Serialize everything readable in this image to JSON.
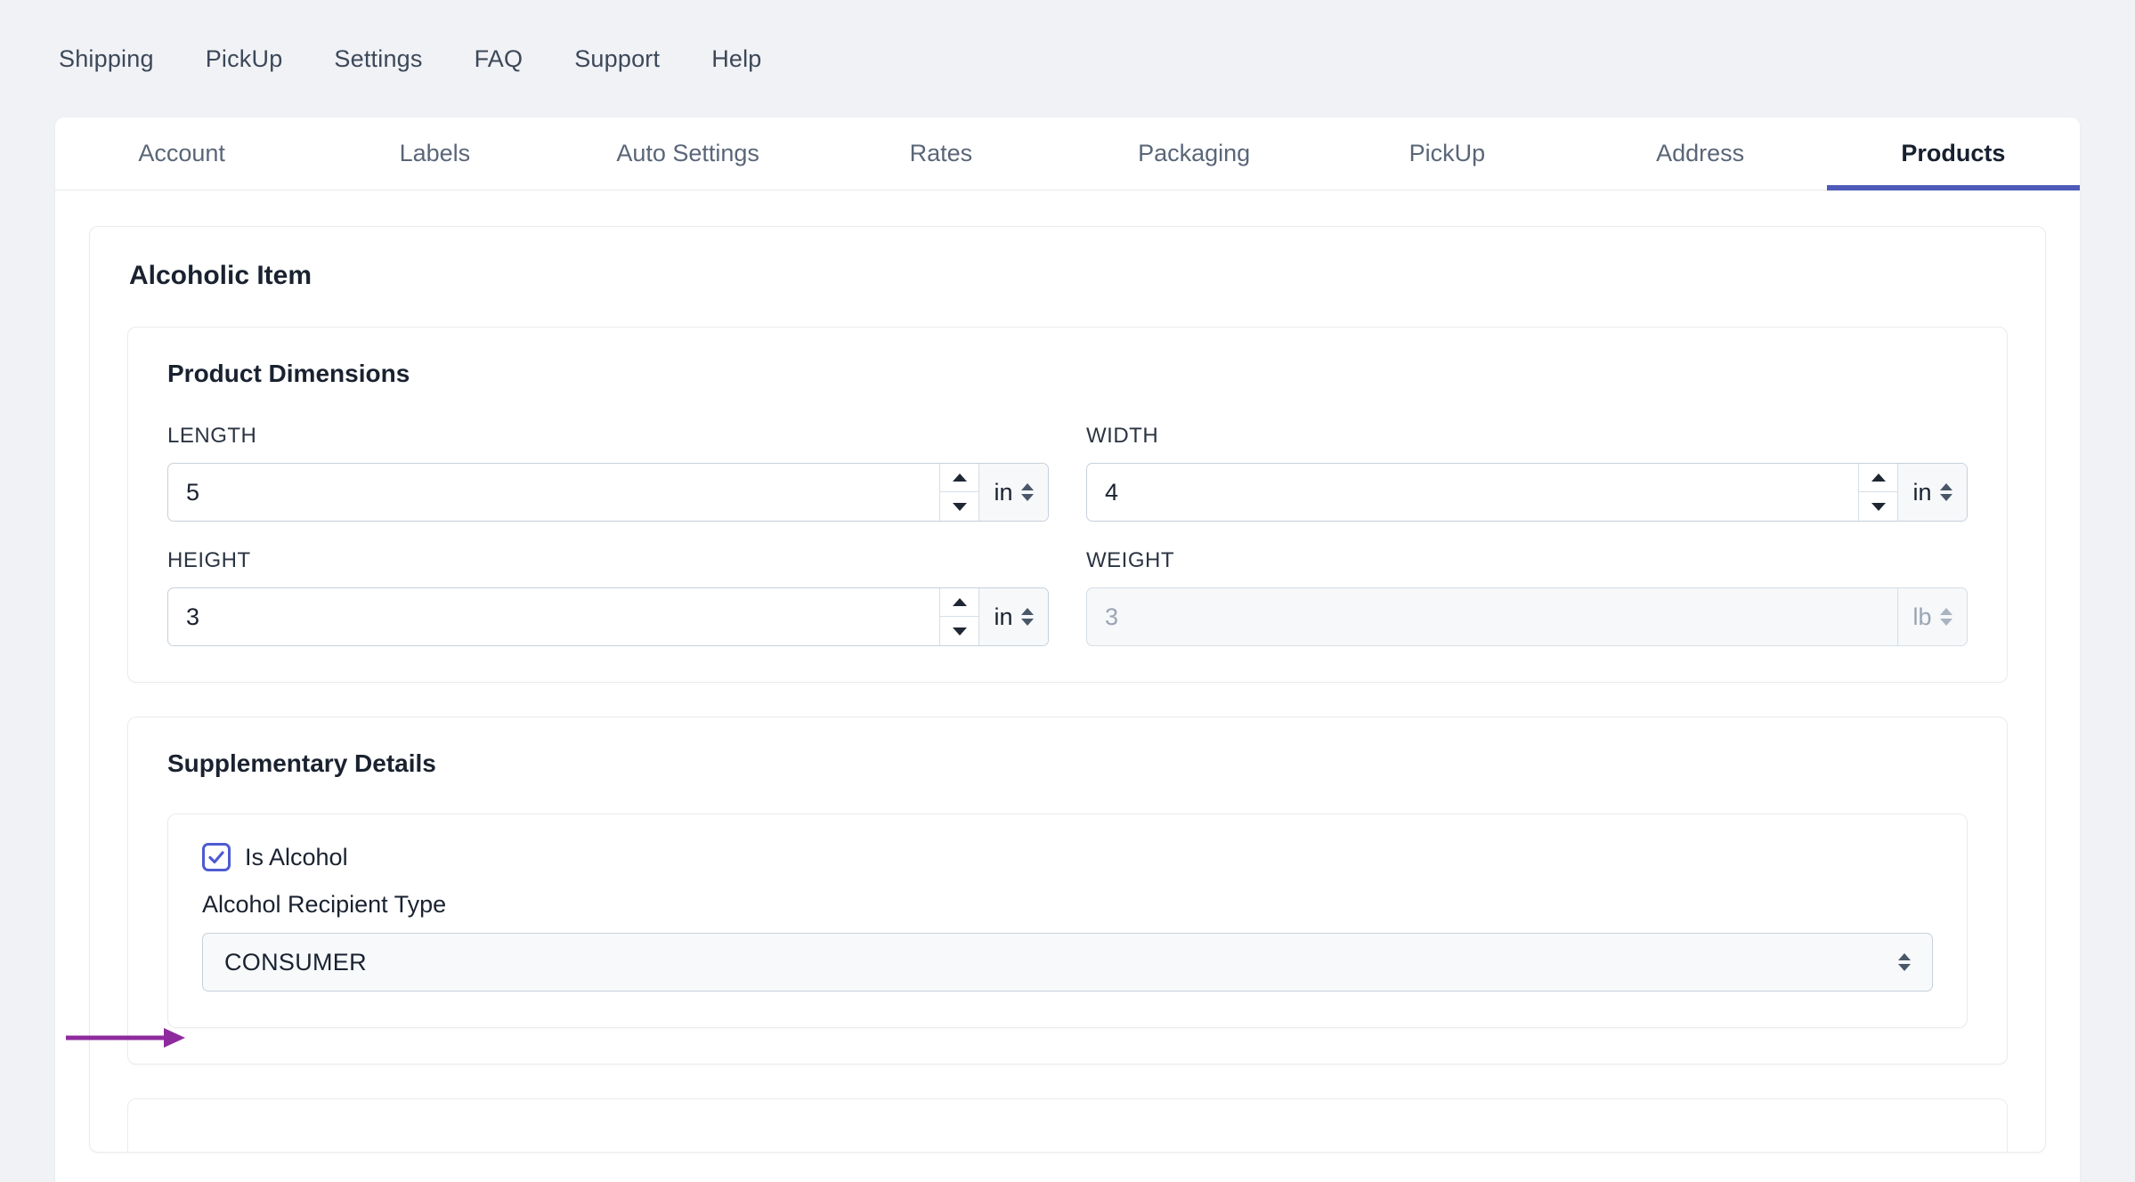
{
  "topnav": {
    "items": [
      {
        "label": "Shipping"
      },
      {
        "label": "PickUp"
      },
      {
        "label": "Settings"
      },
      {
        "label": "FAQ"
      },
      {
        "label": "Support"
      },
      {
        "label": "Help"
      }
    ]
  },
  "tabs": [
    {
      "label": "Account",
      "active": false
    },
    {
      "label": "Labels",
      "active": false
    },
    {
      "label": "Auto Settings",
      "active": false
    },
    {
      "label": "Rates",
      "active": false
    },
    {
      "label": "Packaging",
      "active": false
    },
    {
      "label": "PickUp",
      "active": false
    },
    {
      "label": "Address",
      "active": false
    },
    {
      "label": "Products",
      "active": true
    }
  ],
  "card": {
    "title": "Alcoholic Item"
  },
  "dimensions": {
    "title": "Product Dimensions",
    "length": {
      "label": "LENGTH",
      "value": "5",
      "unit": "in"
    },
    "width": {
      "label": "WIDTH",
      "value": "4",
      "unit": "in"
    },
    "height": {
      "label": "HEIGHT",
      "value": "3",
      "unit": "in"
    },
    "weight": {
      "label": "WEIGHT",
      "value": "",
      "placeholder": "3",
      "unit": "lb"
    }
  },
  "supplementary": {
    "title": "Supplementary Details",
    "is_alcohol": {
      "label": "Is Alcohol",
      "checked": true
    },
    "recipient_type": {
      "label": "Alcohol Recipient Type",
      "value": "CONSUMER"
    }
  },
  "colors": {
    "accent": "#4e5bb8",
    "checkbox": "#4e5bd0",
    "annotation": "#8e2a9e",
    "page_bg": "#f1f2f6",
    "text": "#1a2230"
  },
  "annotation": {
    "target": "recipient-type-select"
  }
}
